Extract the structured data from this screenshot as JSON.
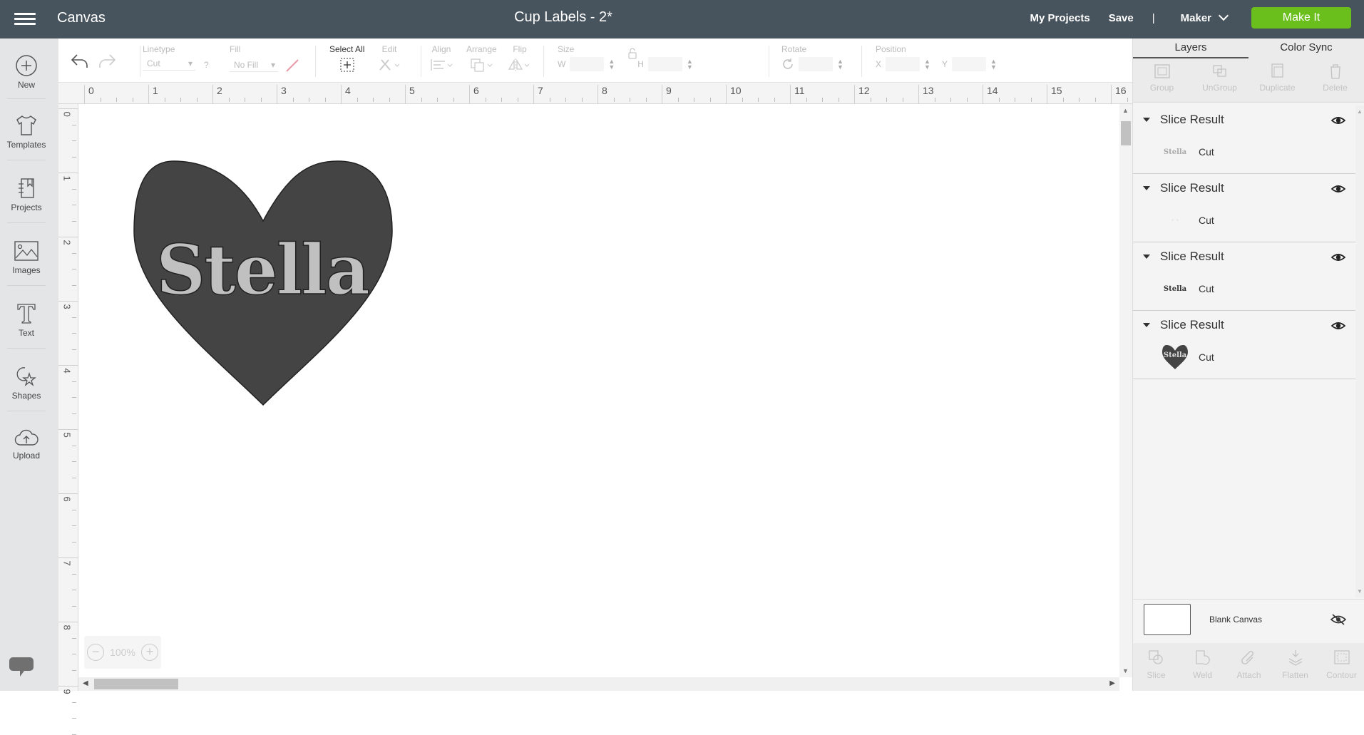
{
  "header": {
    "app_title": "Canvas",
    "document_title": "Cup Labels - 2*",
    "my_projects": "My Projects",
    "save": "Save",
    "separator": "|",
    "machine": "Maker",
    "make_it": "Make It",
    "make_it_color": "#6bbf1c"
  },
  "sidebar": {
    "items": [
      {
        "label": "New",
        "icon": "plus-circle-icon"
      },
      {
        "label": "Templates",
        "icon": "tshirt-icon"
      },
      {
        "label": "Projects",
        "icon": "notebook-icon"
      },
      {
        "label": "Images",
        "icon": "image-icon"
      },
      {
        "label": "Text",
        "icon": "text-icon"
      },
      {
        "label": "Shapes",
        "icon": "shapes-icon"
      },
      {
        "label": "Upload",
        "icon": "cloud-upload-icon"
      }
    ]
  },
  "toolbar": {
    "linetype_label": "Linetype",
    "linetype_value": "Cut",
    "linetype_help": "?",
    "fill_label": "Fill",
    "fill_value": "No Fill",
    "select_all_label": "Select All",
    "edit_label": "Edit",
    "align_label": "Align",
    "arrange_label": "Arrange",
    "flip_label": "Flip",
    "size_label": "Size",
    "w_label": "W",
    "h_label": "H",
    "rotate_label": "Rotate",
    "position_label": "Position",
    "x_label": "X",
    "y_label": "Y"
  },
  "ruler": {
    "horizontal": [
      "0",
      "1",
      "2",
      "3",
      "4",
      "5",
      "6",
      "7",
      "8",
      "9",
      "10",
      "11",
      "12",
      "13",
      "14",
      "15",
      "16"
    ],
    "vertical": [
      "0",
      "1",
      "2",
      "3",
      "4",
      "5",
      "6",
      "7",
      "8",
      "9"
    ]
  },
  "canvas": {
    "design_text": "Stella",
    "zoom_level": "100%",
    "heart_color": "#444444",
    "text_color": "#c0c0c0"
  },
  "right_panel": {
    "tabs": [
      "Layers",
      "Color Sync"
    ],
    "actions": [
      "Group",
      "UnGroup",
      "Duplicate",
      "Delete"
    ],
    "layers": [
      {
        "name": "Slice Result",
        "type": "Cut",
        "thumb_text": "Stella",
        "thumb_style": "light"
      },
      {
        "name": "Slice Result",
        "type": "Cut",
        "thumb_text": "",
        "thumb_style": "empty"
      },
      {
        "name": "Slice Result",
        "type": "Cut",
        "thumb_text": "Stella",
        "thumb_style": "dark"
      },
      {
        "name": "Slice Result",
        "type": "Cut",
        "thumb_text": "Stella",
        "thumb_style": "heart"
      }
    ],
    "blank_canvas_label": "Blank Canvas",
    "bottom_actions": [
      "Slice",
      "Weld",
      "Attach",
      "Flatten",
      "Contour"
    ]
  }
}
